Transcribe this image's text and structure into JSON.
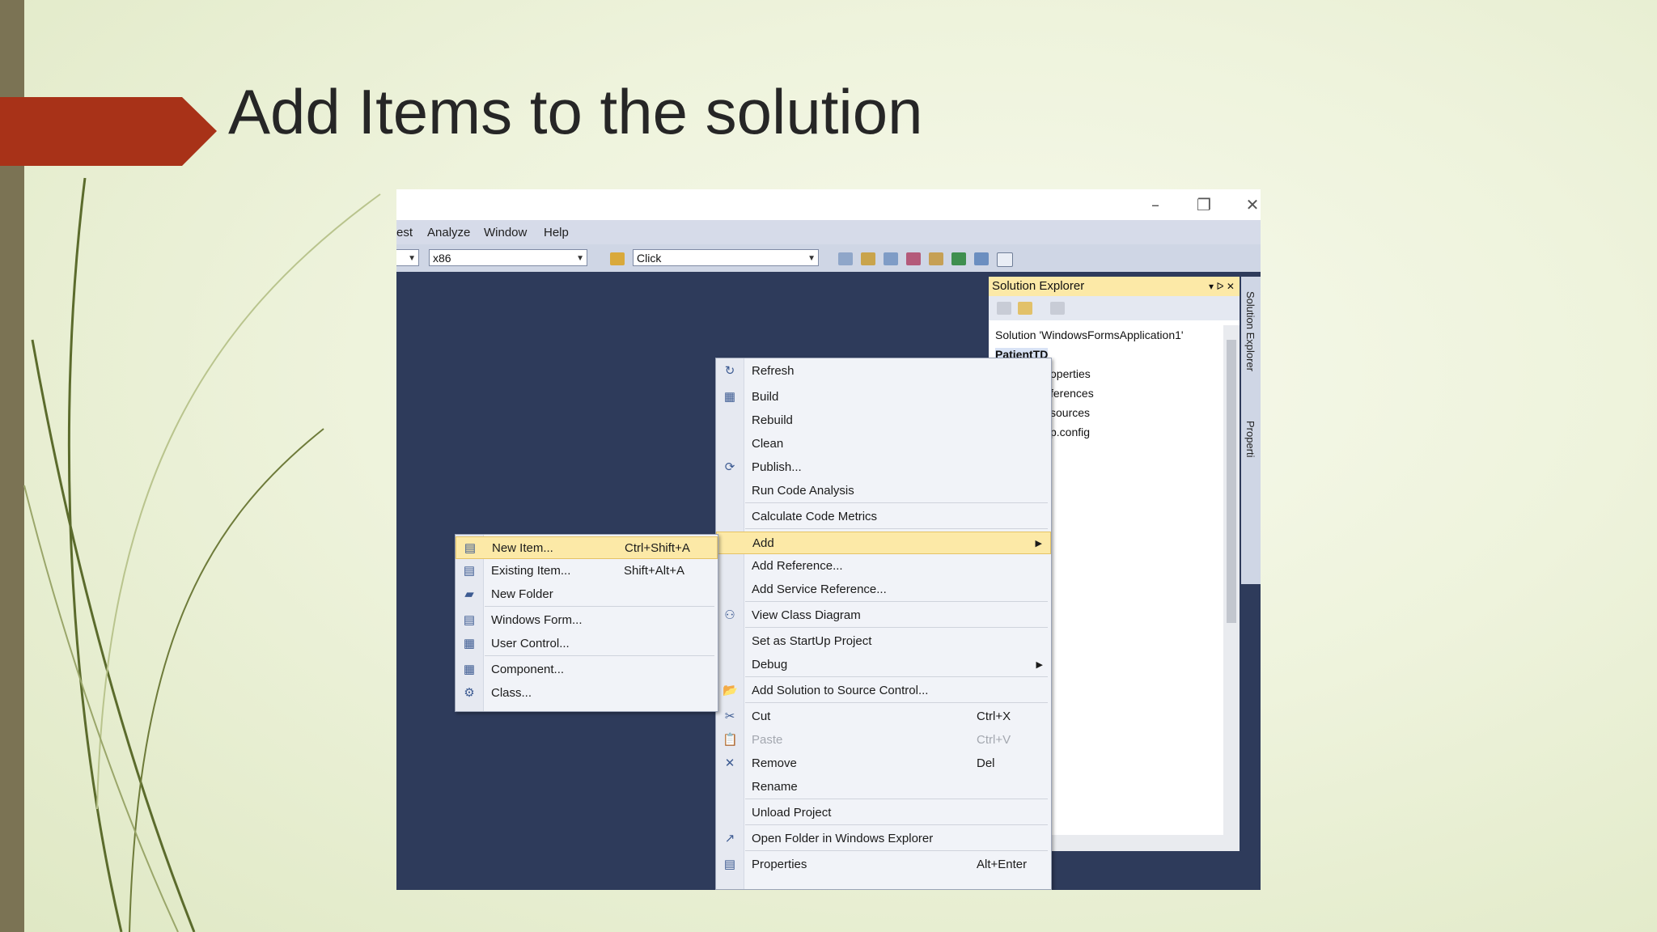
{
  "slide": {
    "title": "Add Items to the solution"
  },
  "window": {
    "minimize_icon": "–",
    "restore_icon": "❐",
    "close_icon": "✕"
  },
  "menubar": [
    "est",
    "Analyze",
    "Window",
    "Help"
  ],
  "toolbar": {
    "platform": "x86",
    "find": "Click"
  },
  "solution_explorer": {
    "title": "Solution Explorer",
    "pin_icons": "▾ ᐅ ✕",
    "tree": [
      "Solution 'WindowsFormsApplication1'",
      "PatientTD",
      "operties",
      "ferences",
      "sources",
      "p.config"
    ]
  },
  "side_tabs": [
    "Solution Explorer",
    "Properti"
  ],
  "context_menu": [
    {
      "label": "Refresh",
      "shortcut": "",
      "icon": "↻"
    },
    {
      "label": "Build",
      "shortcut": "",
      "icon": "▦"
    },
    {
      "label": "Rebuild",
      "shortcut": "",
      "icon": ""
    },
    {
      "label": "Clean",
      "shortcut": "",
      "icon": ""
    },
    {
      "label": "Publish...",
      "shortcut": "",
      "icon": "⟳"
    },
    {
      "label": "Run Code Analysis",
      "shortcut": "",
      "icon": ""
    },
    {
      "label": "Calculate Code Metrics",
      "shortcut": "",
      "icon": ""
    },
    {
      "label": "Add",
      "shortcut": "",
      "icon": ""
    },
    {
      "label": "Add Reference...",
      "shortcut": "",
      "icon": ""
    },
    {
      "label": "Add Service Reference...",
      "shortcut": "",
      "icon": ""
    },
    {
      "label": "View Class Diagram",
      "shortcut": "",
      "icon": "⚇"
    },
    {
      "label": "Set as StartUp Project",
      "shortcut": "",
      "icon": ""
    },
    {
      "label": "Debug",
      "shortcut": "",
      "icon": ""
    },
    {
      "label": "Add Solution to Source Control...",
      "shortcut": "",
      "icon": "📂"
    },
    {
      "label": "Cut",
      "shortcut": "Ctrl+X",
      "icon": "✂"
    },
    {
      "label": "Paste",
      "shortcut": "Ctrl+V",
      "icon": "📋"
    },
    {
      "label": "Remove",
      "shortcut": "Del",
      "icon": "✕"
    },
    {
      "label": "Rename",
      "shortcut": "",
      "icon": ""
    },
    {
      "label": "Unload Project",
      "shortcut": "",
      "icon": ""
    },
    {
      "label": "Open Folder in Windows Explorer",
      "shortcut": "",
      "icon": "↗"
    },
    {
      "label": "Properties",
      "shortcut": "Alt+Enter",
      "icon": "▤"
    }
  ],
  "add_submenu": [
    {
      "label": "New Item...",
      "shortcut": "Ctrl+Shift+A",
      "icon": "▤"
    },
    {
      "label": "Existing Item...",
      "shortcut": "Shift+Alt+A",
      "icon": "▤"
    },
    {
      "label": "New Folder",
      "shortcut": "",
      "icon": "▰"
    },
    {
      "label": "Windows Form...",
      "shortcut": "",
      "icon": "▤"
    },
    {
      "label": "User Control...",
      "shortcut": "",
      "icon": "▦"
    },
    {
      "label": "Component...",
      "shortcut": "",
      "icon": "▦"
    },
    {
      "label": "Class...",
      "shortcut": "",
      "icon": "⚙"
    }
  ],
  "colors": {
    "accent": "#a83218",
    "ide_bg": "#2e3b5b",
    "highlight": "#fce9a7"
  }
}
